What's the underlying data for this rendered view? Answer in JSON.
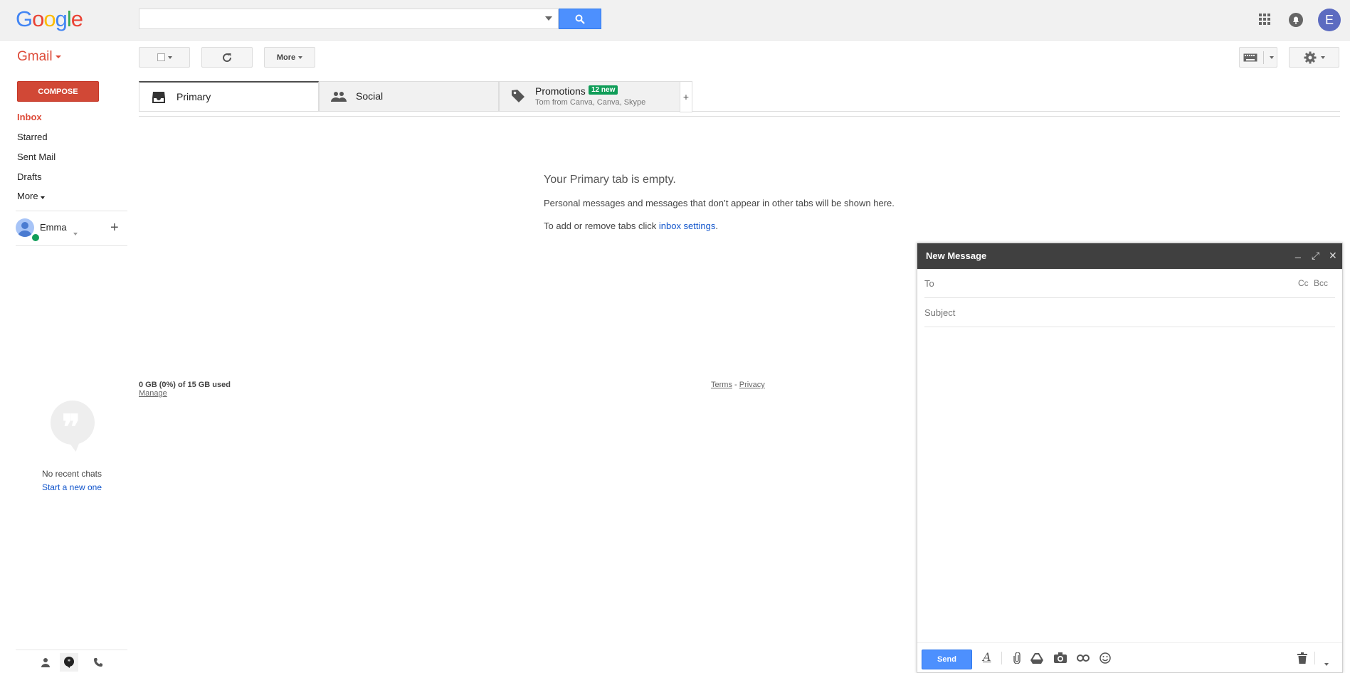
{
  "header": {
    "logo_letters": [
      "G",
      "o",
      "o",
      "g",
      "l",
      "e"
    ],
    "search": {
      "value": "",
      "placeholder": ""
    },
    "account_initial": "E"
  },
  "toolbar": {
    "app_label": "Gmail",
    "more_label": "More"
  },
  "nav": {
    "compose_label": "COMPOSE",
    "items": [
      {
        "label": "Inbox",
        "active": true
      },
      {
        "label": "Starred"
      },
      {
        "label": "Sent Mail"
      },
      {
        "label": "Drafts"
      },
      {
        "label": "More"
      }
    ],
    "user_name": "Emma",
    "add_icon": "+"
  },
  "chat": {
    "empty_text": "No recent chats",
    "start_link": "Start a new one"
  },
  "tabs": [
    {
      "label": "Primary",
      "icon": "inbox-icon",
      "active": true
    },
    {
      "label": "Social",
      "icon": "people-icon"
    },
    {
      "label": "Promotions",
      "icon": "tag-icon",
      "badge": "12 new",
      "subtitle": "Tom from Canva, Canva, Skype"
    }
  ],
  "tab_add_label": "+",
  "empty_state": {
    "title": "Your Primary tab is empty.",
    "description": "Personal messages and messages that don’t appear in other tabs will be shown here.",
    "tabs_hint": "To add or remove tabs click ",
    "settings_link": "inbox settings",
    "period": "."
  },
  "footer": {
    "storage": "0 GB (0%) of 15 GB used",
    "manage": "Manage",
    "terms": "Terms",
    "separator": " - ",
    "privacy": "Privacy"
  },
  "compose": {
    "title": "New Message",
    "to_label": "To",
    "cc_label": "Cc",
    "bcc_label": "Bcc",
    "subject_placeholder": "Subject",
    "body": "",
    "send_label": "Send"
  },
  "colors": {
    "compose_red": "#d14836",
    "send_blue": "#4d90fe",
    "inbox_red": "#dd4b39",
    "badge_green": "#0f9d58",
    "compose_header": "#404040"
  }
}
